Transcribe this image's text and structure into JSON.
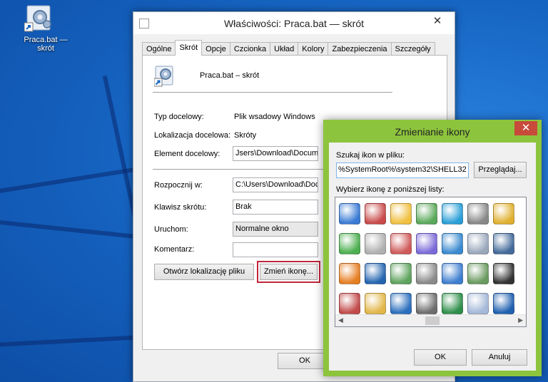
{
  "desktop": {
    "icon_label": "Praca.bat — skrót"
  },
  "properties_window": {
    "title": "Właściwości: Praca.bat — skrót",
    "tabs": [
      "Ogólne",
      "Skrót",
      "Opcje",
      "Czcionka",
      "Układ",
      "Kolory",
      "Zabezpieczenia",
      "Szczegóły"
    ],
    "active_tab": "Skrót",
    "shortcut_name": "Praca.bat – skrót",
    "target_type_label": "Typ docelowy:",
    "target_type_value": "Plik wsadowy Windows",
    "target_location_label": "Lokalizacja docelowa:",
    "target_location_value": "Skróty",
    "target_label": "Element docelowy:",
    "target_value": "Jsers\\Download\\Documer",
    "start_in_label": "Rozpocznij w:",
    "start_in_value": "C:\\Users\\Download\\Docu",
    "shortcut_key_label": "Klawisz skrótu:",
    "shortcut_key_value": "Brak",
    "run_label": "Uruchom:",
    "run_value": "Normalne okno",
    "comment_label": "Komentarz:",
    "comment_value": "",
    "open_location_button": "Otwórz lokalizację pliku",
    "change_icon_button": "Zmień ikonę...",
    "ok_button": "OK",
    "close_glyph": "✕"
  },
  "change_icon_dialog": {
    "title": "Zmienianie ikony",
    "search_label": "Szukaj ikon w pliku:",
    "file_path_value": "%SystemRoot%\\system32\\SHELL32",
    "browse_button": "Przeglądaj...",
    "list_label": "Wybierz ikonę z poniższej listy:",
    "icons": [
      "network-folder-icon",
      "document-error-icon",
      "mail-envelope-icon",
      "users-icon",
      "globe-network-icon",
      "speaker-icon",
      "help-balloon-icon",
      "network-add-icon",
      "cd-drive-icon",
      "cd-audio-icon",
      "display-settings-icon",
      "checklist-icon",
      "gear-settings-icon",
      "computer-keyboard-icon",
      "home-network-icon",
      "question-icon",
      "user-group-icon",
      "file-cabinet-icon",
      "pie-chart-icon",
      "users-pair-icon",
      "monitor-off-icon",
      "cd-burn-icon",
      "folder-icon",
      "fullscreen-icon",
      "printer-icon",
      "globe-clock-icon",
      "magnifier-document-icon",
      "help-document-icon"
    ],
    "ok_button": "OK",
    "cancel_button": "Anuluj",
    "close_glyph": "✕"
  },
  "colors": {
    "desktop_blue": "#1766c4",
    "dialog_border_green": "#8dc43d",
    "focus_red": "#c0263a",
    "close_red": "#c74a3a"
  }
}
